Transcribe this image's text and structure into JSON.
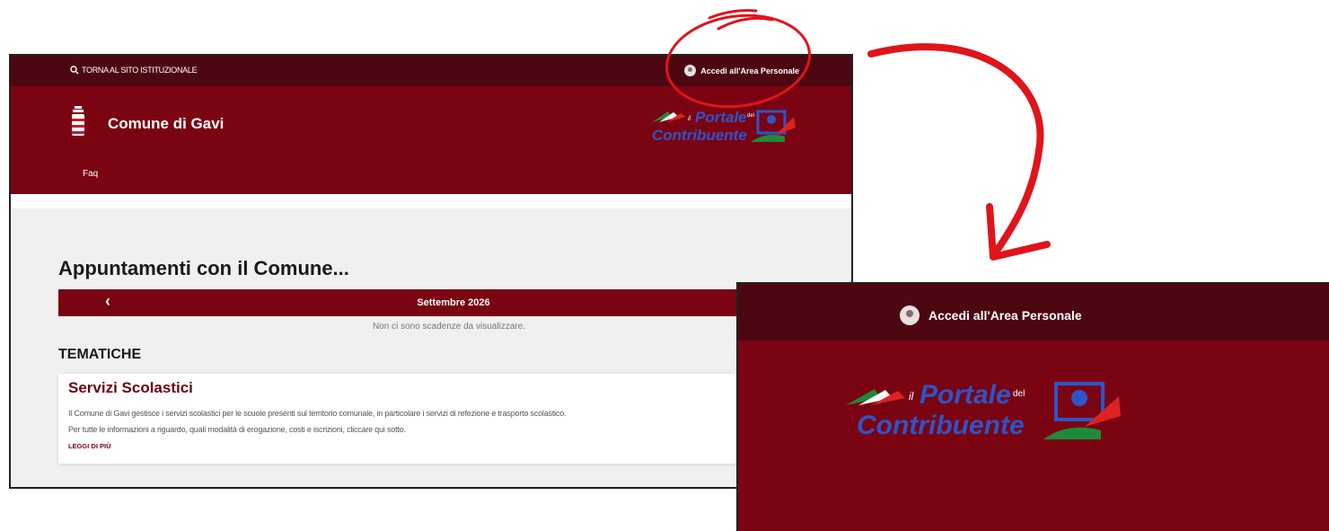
{
  "topbar": {
    "back_link": "TORNA AL SITO ISTITUZIONALE",
    "login": "Accedi all'Area Personale"
  },
  "header": {
    "site_title": "Comune di Gavi",
    "nav_faq": "Faq",
    "logo_text_line1": "Portale",
    "logo_text_small": "del",
    "logo_text_prefix": "il",
    "logo_text_line2": "Contribuente"
  },
  "appointments": {
    "title": "Appuntamenti con il Comune...",
    "month": "Settembre 2026",
    "empty_message": "Non ci sono scadenze da visualizzare."
  },
  "themes": {
    "title": "TEMATICHE",
    "card": {
      "title": "Servizi Scolastici",
      "line1": "Il Comune di Gavi gestisce i servizi scolastici per le scuole presenti sul territorio comunale, in particolare i servizi di refezione e trasporto scolastico.",
      "line2": "Per tutte le informazioni a riguardo, quali modalità di erogazione, costi e iscrizioni, cliccare qui sotto.",
      "read_more": "LEGGI DI PIÙ"
    }
  },
  "zoom": {
    "login": "Accedi all'Area Personale"
  },
  "colors": {
    "brand_dark": "#4d0710",
    "brand": "#7a0412",
    "annotation": "#e0141b",
    "logo_blue": "#2c55c8"
  },
  "icons": [
    "search-icon",
    "user-avatar-icon",
    "crest-icon",
    "chevron-left-icon",
    "portale-contribuente-logo"
  ]
}
